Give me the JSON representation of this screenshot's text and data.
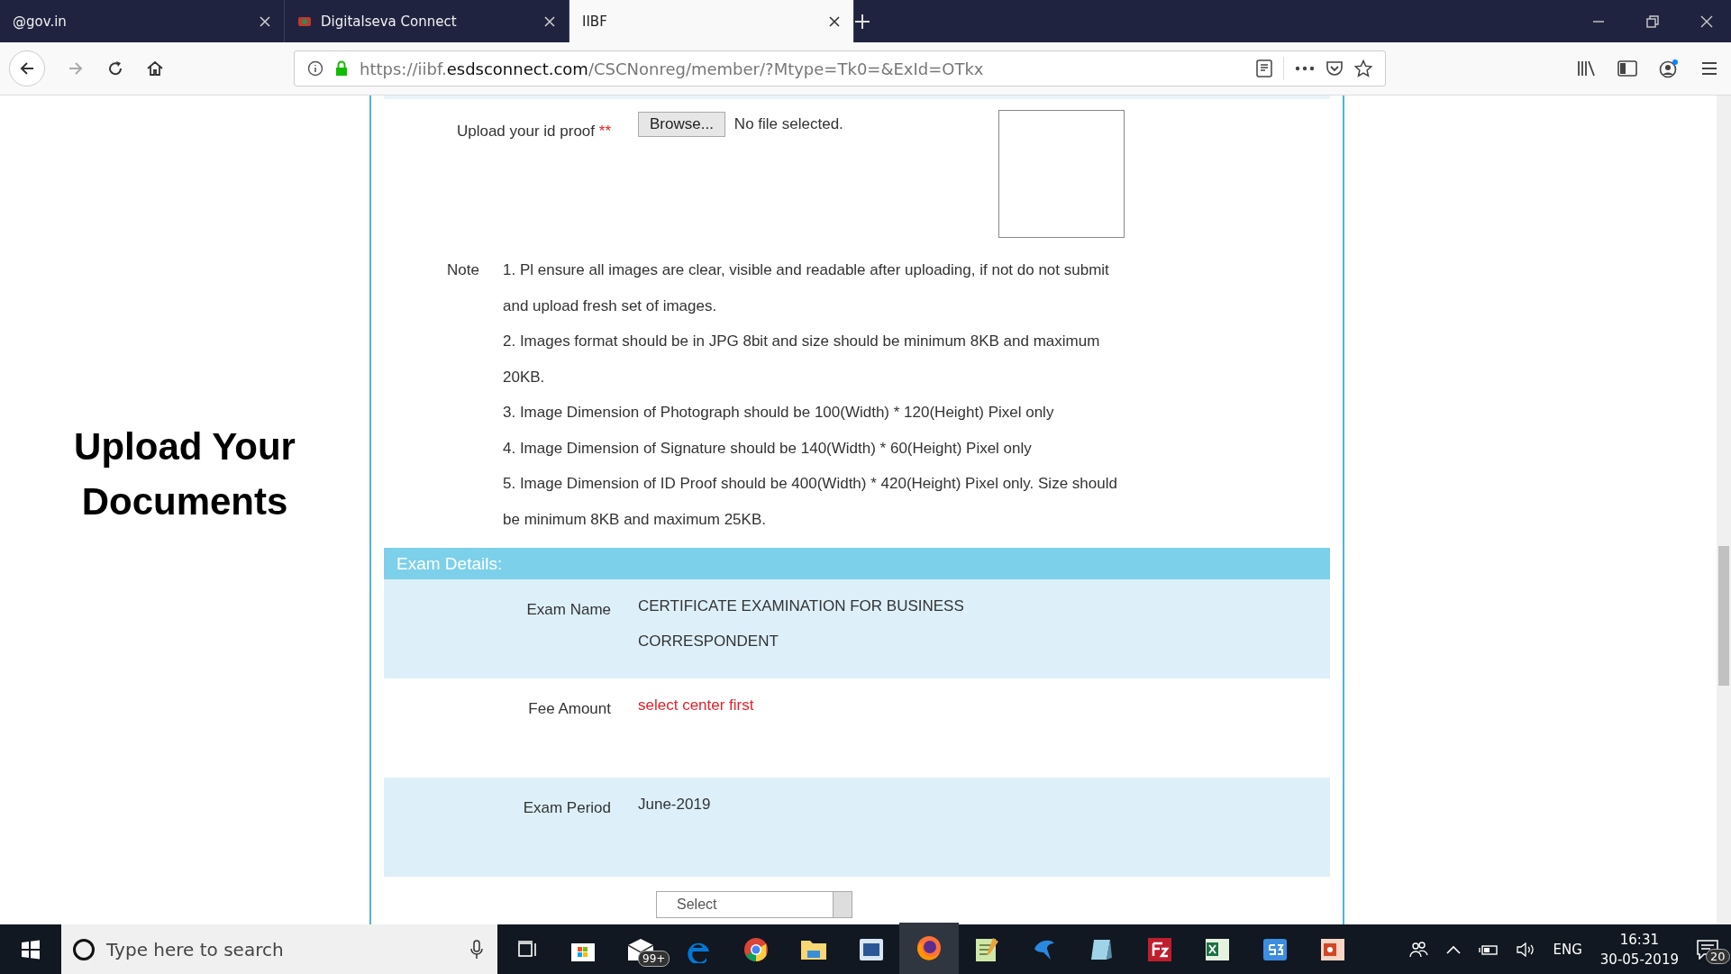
{
  "browser": {
    "tabs": [
      {
        "title": "@gov.in",
        "selected": false,
        "kind": "plain"
      },
      {
        "title": "Digitalseva Connect",
        "selected": false,
        "kind": "favicon"
      },
      {
        "title": "IIBF",
        "selected": true,
        "kind": "plain"
      }
    ],
    "url": {
      "start": "https://iibf.",
      "domain": "esdsconnect.com",
      "path": "/CSCNonreg/member/?Mtype=Tk0=&ExId=OTkx"
    }
  },
  "page": {
    "heading": "Upload Your Documents",
    "upload": {
      "label": "Upload your id proof",
      "required": "**",
      "button": "Browse...",
      "status": "No file selected."
    },
    "note": {
      "label": "Note",
      "items": [
        "1. Pl ensure all images are clear, visible and readable after uploading, if not do not submit and upload fresh set of images.",
        "2. Images format should be in JPG 8bit and size should be minimum 8KB and maximum 20KB.",
        "3. Image Dimension of Photograph should be 100(Width) * 120(Height) Pixel only",
        "4. Image Dimension of Signature should be 140(Width) * 60(Height) Pixel only",
        "5. Image Dimension of ID Proof should be 400(Width) * 420(Height) Pixel only. Size should be minimum 8KB and maximum 25KB."
      ]
    },
    "section": "Exam Details:",
    "rows": [
      {
        "label": "Exam Name",
        "value": "CERTIFICATE EXAMINATION FOR BUSINESS CORRESPONDENT",
        "kind": "text",
        "shaded": true
      },
      {
        "label": "Fee Amount",
        "value": "select center first",
        "kind": "error",
        "shaded": false
      },
      {
        "label": "Exam Period",
        "value": "June-2019",
        "kind": "text",
        "shaded": true
      }
    ],
    "medium_select": "Select"
  },
  "taskbar": {
    "search_placeholder": "Type here to search",
    "mail_badge": "99+",
    "language": "ENG",
    "time": "16:31",
    "date": "30-05-2019",
    "notifications": "20"
  }
}
